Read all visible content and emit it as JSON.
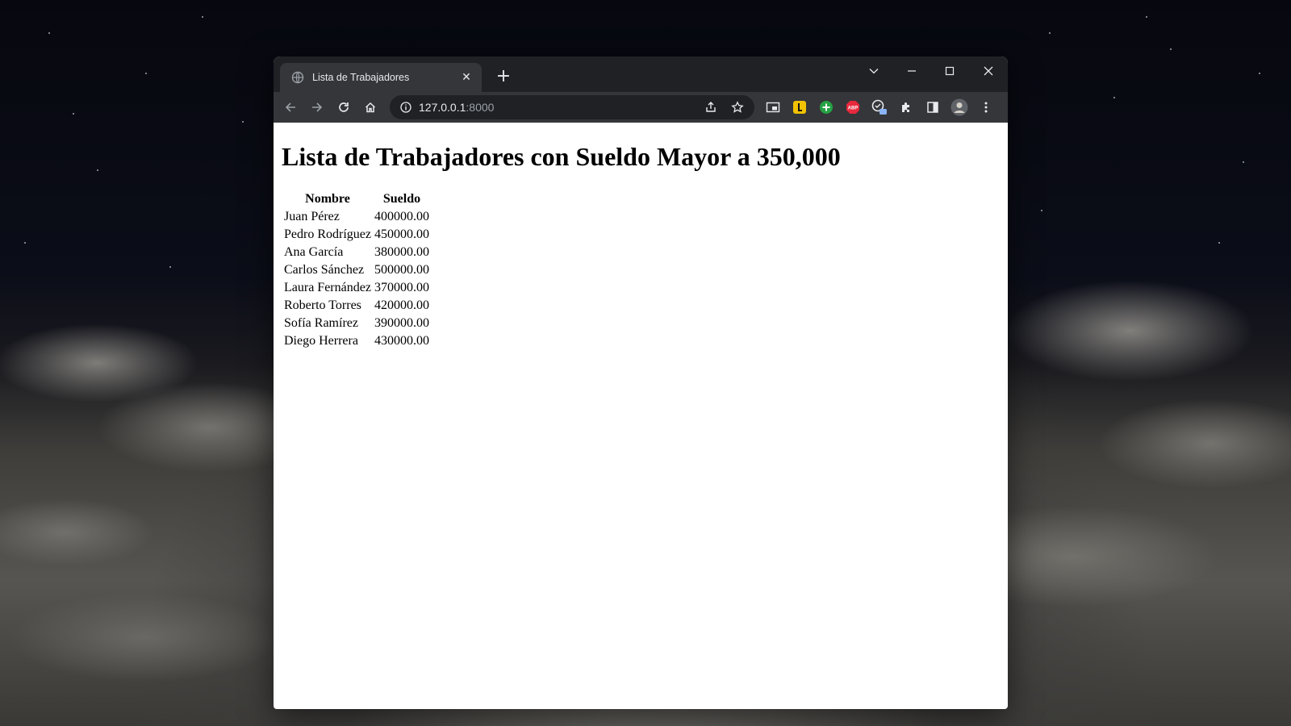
{
  "browser": {
    "tab_title": "Lista de Trabajadores",
    "url_host": "127.0.0.1",
    "url_port": ":8000"
  },
  "page": {
    "heading": "Lista de Trabajadores con Sueldo Mayor a 350,000",
    "columns": [
      "Nombre",
      "Sueldo"
    ],
    "rows": [
      {
        "nombre": "Juan Pérez",
        "sueldo": "400000.00"
      },
      {
        "nombre": "Pedro Rodríguez",
        "sueldo": "450000.00"
      },
      {
        "nombre": "Ana García",
        "sueldo": "380000.00"
      },
      {
        "nombre": "Carlos Sánchez",
        "sueldo": "500000.00"
      },
      {
        "nombre": "Laura Fernández",
        "sueldo": "370000.00"
      },
      {
        "nombre": "Roberto Torres",
        "sueldo": "420000.00"
      },
      {
        "nombre": "Sofía Ramírez",
        "sueldo": "390000.00"
      },
      {
        "nombre": "Diego Herrera",
        "sueldo": "430000.00"
      }
    ]
  },
  "icons": {
    "tab_favicon": "globe-icon",
    "tab_close": "close-icon",
    "new_tab": "plus-icon",
    "tab_search": "chevron-down-icon",
    "minimize": "minimize-icon",
    "maximize": "maximize-icon",
    "window_close": "close-icon",
    "back": "arrow-left-icon",
    "forward": "arrow-right-icon",
    "reload": "reload-icon",
    "home": "home-icon",
    "site_info": "info-icon",
    "share": "share-icon",
    "bookmark": "star-icon",
    "extensions": [
      "picture-in-picture-icon",
      "extension-l-icon",
      "extension-plus-icon",
      "adblock-icon",
      "extension-badge-icon",
      "puzzle-icon",
      "side-panel-icon",
      "profile-avatar-icon",
      "kebab-menu-icon"
    ]
  },
  "colors": {
    "tabstrip": "#202124",
    "toolbar": "#35363a",
    "text_light": "#e8eaed",
    "abp_red": "#e8283c",
    "ext_yellow": "#f2c200",
    "ext_green": "#25a244"
  }
}
